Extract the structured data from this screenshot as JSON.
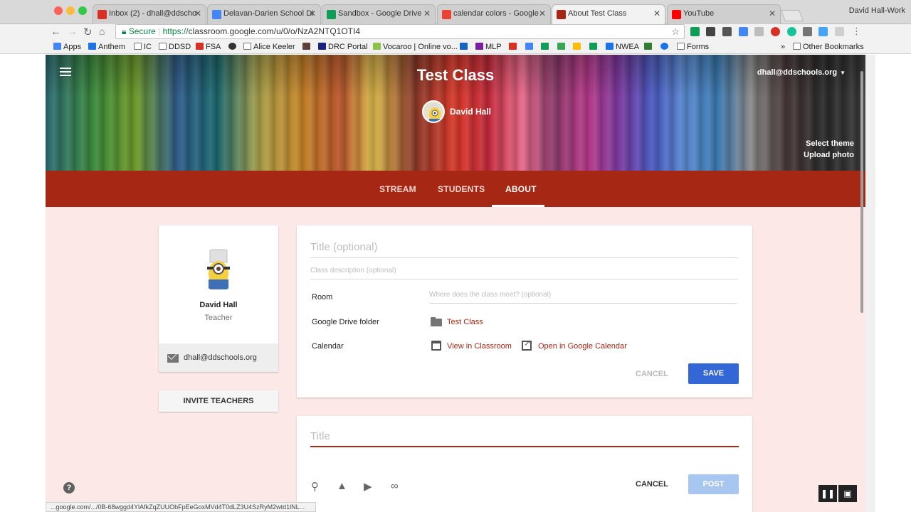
{
  "browser": {
    "tabs": [
      {
        "title": "Inbox (2) - dhall@ddscho",
        "color": "#d93025"
      },
      {
        "title": "Delavan-Darien School Di",
        "color": "#4285f4"
      },
      {
        "title": "Sandbox - Google Drive",
        "color": "#0f9d58"
      },
      {
        "title": "calendar colors - Google",
        "color": "#ea4335"
      },
      {
        "title": "About Test Class",
        "color": "#a52714"
      },
      {
        "title": "YouTube",
        "color": "#ff0000"
      }
    ],
    "profile": "David Hall-Work",
    "secure_label": "Secure",
    "url_scheme": "https://",
    "url_rest": "classroom.google.com/u/0/o/NzA2NTQ1OTI4",
    "bookmarks": [
      {
        "label": "Apps",
        "color": "#4285f4"
      },
      {
        "label": "Anthem",
        "color": "#1a73e8"
      },
      {
        "label": "IC",
        "color": "#757575"
      },
      {
        "label": "DDSD",
        "color": "#757575"
      },
      {
        "label": "FSA",
        "color": "#d93025"
      },
      {
        "label": "",
        "color": "#333333"
      },
      {
        "label": "Alice Keeler",
        "color": "#757575"
      },
      {
        "label": "",
        "color": "#5d4037"
      },
      {
        "label": "DRC Portal",
        "color": "#1a237e"
      },
      {
        "label": "Vocaroo | Online vo...",
        "color": "#8bc34a"
      },
      {
        "label": "",
        "color": "#1565c0"
      },
      {
        "label": "MLP",
        "color": "#7b1fa2"
      },
      {
        "label": "",
        "color": "#d93025"
      },
      {
        "label": "",
        "color": "#4285f4"
      },
      {
        "label": "",
        "color": "#0f9d58"
      },
      {
        "label": "",
        "color": "#34a853"
      },
      {
        "label": "",
        "color": "#fbbc04"
      },
      {
        "label": "",
        "color": "#0f9d58"
      },
      {
        "label": "NWEA",
        "color": "#1a73e8"
      },
      {
        "label": "",
        "color": "#2e7d32"
      },
      {
        "label": "",
        "color": "#1a73e8"
      },
      {
        "label": "Forms",
        "color": "#757575"
      }
    ],
    "other_bookmarks": "Other Bookmarks",
    "status_url": "...google.com/.../0B-68wggd4YlAfkZqZUUObFpEeGoxMVd4T0dLZ3U4SzRyM2wtd1lNL..."
  },
  "classroom": {
    "class_title": "Test Class",
    "teacher_name": "David Hall",
    "account": "dhall@ddschools.org",
    "select_theme": "Select theme",
    "upload_photo": "Upload photo",
    "tabs": [
      "STREAM",
      "STUDENTS",
      "ABOUT"
    ],
    "active_tab": "ABOUT",
    "accent_color": "#a52714"
  },
  "profile_card": {
    "name": "David Hall",
    "role": "Teacher",
    "email": "dhall@ddschools.org",
    "invite_label": "INVITE TEACHERS"
  },
  "about_form": {
    "title_placeholder": "Title (optional)",
    "description_placeholder": "Class description (optional)",
    "room_label": "Room",
    "room_placeholder": "Where does the class meet? (optional)",
    "drive_label": "Google Drive folder",
    "drive_folder": "Test Class",
    "calendar_label": "Calendar",
    "view_in_classroom": "View in Classroom",
    "open_in_calendar": "Open in Google Calendar",
    "cancel_label": "CANCEL",
    "save_label": "SAVE"
  },
  "post_form": {
    "title_placeholder": "Title",
    "cancel_label": "CANCEL",
    "post_label": "POST"
  }
}
